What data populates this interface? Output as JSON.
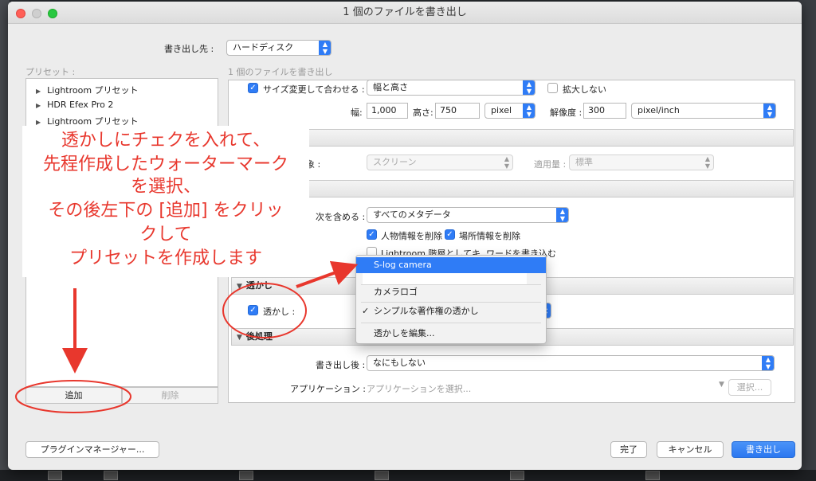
{
  "window": {
    "title": "1 個のファイルを書き出し"
  },
  "export_to": {
    "label": "書き出し先 :",
    "value": "ハードディスク"
  },
  "presets": {
    "header": "プリセット :",
    "items": [
      "Lightroom プリセット",
      "HDR Efex Pro 2",
      "Lightroom プリセット"
    ],
    "add_button": "追加",
    "remove_button": "削除"
  },
  "panel_header": "1 個のファイルを書き出し",
  "resize": {
    "checkbox_label": "サイズ変更して合わせる :",
    "mode": "幅と高さ",
    "no_enlarge_label": "拡大しない",
    "width_label": "幅:",
    "width_value": "1,000",
    "height_label": "高さ:",
    "height_value": "750",
    "unit": "pixel",
    "resolution_label": "解像度 :",
    "resolution_value": "300",
    "resolution_unit": "pixel/inch"
  },
  "sharpen": {
    "target_label_partial": "象 :",
    "target_value": "スクリーン",
    "amount_label": "適用量 :",
    "amount_value": "標準"
  },
  "metadata": {
    "include_label": "次を含める :",
    "include_value": "すべてのメタデータ",
    "remove_person_label": "人物情報を削除",
    "remove_location_label": "場所情報を削除",
    "keywords_partial_left": "Lightroom 階層としてキ",
    "keywords_partial_right": "ワードを書き込む"
  },
  "watermark": {
    "section_title": "透かし",
    "checkbox_label": "透かし :",
    "dropdown": {
      "highlighted": "S-log camera",
      "items": [
        "カメラロゴ",
        "シンプルな著作権の透かし",
        "透かしを編集..."
      ],
      "checked_item": "シンプルな著作権の透かし"
    }
  },
  "post_processing": {
    "section_title": "後処理",
    "after_export_label": "書き出し後 :",
    "after_export_value": "なにもしない",
    "application_label": "アプリケーション :",
    "application_placeholder": "アプリケーションを選択...",
    "choose_button": "選択..."
  },
  "footer": {
    "plugin_manager": "プラグインマネージャー...",
    "done": "完了",
    "cancel": "キャンセル",
    "export": "書き出し"
  },
  "annotation": {
    "lines": [
      "透かしにチェクを入れて、",
      "先程作成したウォーターマーク",
      "を選択、",
      "その後左下の [追加] をクリッ",
      "クして",
      "プリセットを作成します"
    ]
  },
  "colors": {
    "accent": "#2f7cf6",
    "annotation": "#e8372d"
  }
}
